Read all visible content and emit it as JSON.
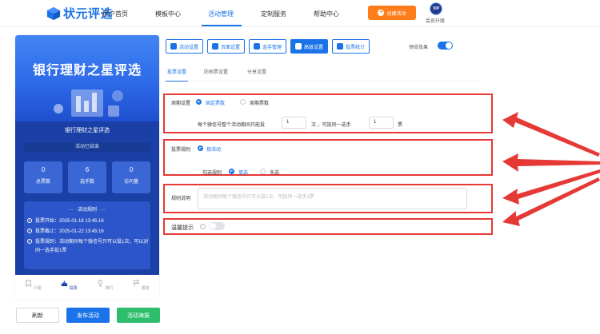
{
  "brand": {
    "name": "状元评选",
    "color": "#1a73e8"
  },
  "nav": {
    "items": [
      "用户首页",
      "模板中心",
      "活动管理",
      "定制服务",
      "帮助中心"
    ],
    "active_index": 2,
    "create_label": "创建活动",
    "vip_badge": "VIP",
    "vip_label": "会员升级"
  },
  "preview": {
    "banner_title": "银行理财之星评选",
    "sub_title": "银行理财之星评选",
    "status": "活动已结束",
    "stats": [
      {
        "value": "0",
        "label": "总票数"
      },
      {
        "value": "6",
        "label": "选手数"
      },
      {
        "value": "0",
        "label": "访问量"
      }
    ],
    "rules_title": "活动规则",
    "rules": [
      "投票开始：2025-01-16 13:45:16",
      "投票截止：2025-01-22 13:45:16",
      "投票规则：活动期间每个微信号只可以投1次，可以对同一选手投1票"
    ],
    "tabs": [
      "介绍",
      "投票",
      "排行",
      "报名"
    ],
    "active_tab": 1
  },
  "buttons": {
    "refresh": "刷新",
    "publish": "发布活动",
    "poster": "活动海报"
  },
  "toolbar": {
    "items": [
      "活动设置",
      "页面设置",
      "选手管理",
      "高级设置",
      "投票统计"
    ],
    "active_index": 3,
    "preview_label": "预览效果",
    "preview_on": true
  },
  "subtabs": {
    "items": [
      "投票设置",
      "防刷票设置",
      "分享设置"
    ],
    "active_index": 0
  },
  "settings": {
    "cycle": {
      "label": "周期设置",
      "options": [
        "固定票数",
        "周期票数"
      ],
      "selected": 0,
      "text_before": "每个微信号整个活动期间只能投",
      "count_value": "1",
      "text_mid": "次 ，可投同一选手",
      "same_value": "1",
      "text_after": "票"
    },
    "rule": {
      "label": "投票规则",
      "option": "按活动",
      "check_label": "勾选规则",
      "check_options": [
        "单选",
        "多选"
      ],
      "check_selected": 0
    },
    "desc": {
      "label": "规则说明",
      "placeholder": "活动期间每个微信号只可以投1次，可投同一选手1票"
    },
    "tip": {
      "label": "温馨提示",
      "enabled": false
    }
  },
  "colors": {
    "accent": "#1a73e8",
    "orange": "#ff7d1a",
    "green": "#2ebd6b",
    "red": "#e53935",
    "phone_bg": "#1a3fa6"
  }
}
